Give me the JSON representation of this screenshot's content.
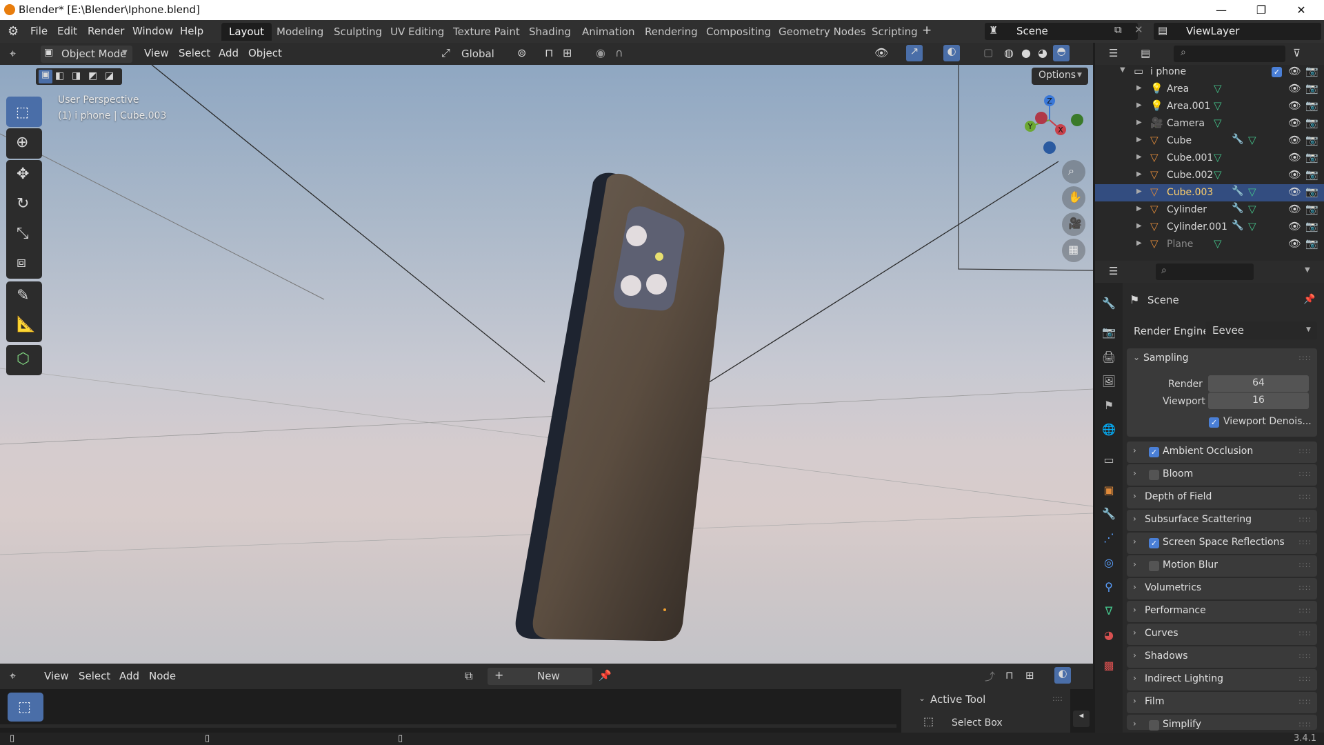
{
  "window": {
    "title": "Blender* [E:\\Blender\\Iphone.blend]",
    "controls": [
      "—",
      "❐",
      "✕"
    ]
  },
  "menu": [
    "File",
    "Edit",
    "Render",
    "Window",
    "Help"
  ],
  "workspaces": [
    {
      "label": "Layout",
      "active": true
    },
    {
      "label": "Modeling"
    },
    {
      "label": "Sculpting"
    },
    {
      "label": "UV Editing"
    },
    {
      "label": "Texture Paint"
    },
    {
      "label": "Shading"
    },
    {
      "label": "Animation"
    },
    {
      "label": "Rendering"
    },
    {
      "label": "Compositing"
    },
    {
      "label": "Geometry Nodes"
    },
    {
      "label": "Scripting"
    }
  ],
  "add_workspace": "+",
  "scene_name": "Scene",
  "view_layer": "ViewLayer",
  "viewport_header": {
    "mode": "Object Mode",
    "menus": [
      "View",
      "Select",
      "Add",
      "Object"
    ],
    "transform_orientation": "Global"
  },
  "viewport": {
    "perspective_label": "User Perspective",
    "object_label": "(1) i phone | Cube.003",
    "options_label": "Options",
    "gizmo_axes": {
      "x": "X",
      "y": "Y",
      "z": "Z"
    }
  },
  "outliner": {
    "collection": "i phone",
    "items": [
      {
        "name": "Area",
        "icon": "light-icon",
        "selected": false
      },
      {
        "name": "Area.001",
        "icon": "light-icon",
        "selected": false
      },
      {
        "name": "Camera",
        "icon": "camera-icon",
        "selected": false
      },
      {
        "name": "Cube",
        "icon": "mesh-icon",
        "selected": false
      },
      {
        "name": "Cube.001",
        "icon": "mesh-icon",
        "selected": false
      },
      {
        "name": "Cube.002",
        "icon": "mesh-icon",
        "selected": false
      },
      {
        "name": "Cube.003",
        "icon": "mesh-icon",
        "selected": true
      },
      {
        "name": "Cylinder",
        "icon": "mesh-icon",
        "selected": false
      },
      {
        "name": "Cylinder.001",
        "icon": "mesh-icon",
        "selected": false
      },
      {
        "name": "Plane",
        "icon": "mesh-icon",
        "selected": false
      }
    ]
  },
  "properties": {
    "context": "Scene",
    "render_engine_label": "Render Engine",
    "render_engine": "Eevee",
    "sampling": {
      "label": "Sampling",
      "render_label": "Render",
      "render_value": "64",
      "viewport_label": "Viewport",
      "viewport_value": "16",
      "denoise_label": "Viewport Denois..."
    },
    "panels": [
      {
        "label": "Ambient Occlusion",
        "checkbox": true
      },
      {
        "label": "Bloom",
        "checkbox": false
      },
      {
        "label": "Depth of Field"
      },
      {
        "label": "Subsurface Scattering"
      },
      {
        "label": "Screen Space Reflections",
        "checkbox": true
      },
      {
        "label": "Motion Blur",
        "checkbox": false
      },
      {
        "label": "Volumetrics"
      },
      {
        "label": "Performance"
      },
      {
        "label": "Curves"
      },
      {
        "label": "Shadows"
      },
      {
        "label": "Indirect Lighting"
      },
      {
        "label": "Film"
      },
      {
        "label": "Simplify",
        "checkbox": false
      }
    ]
  },
  "node_editor": {
    "menus": [
      "View",
      "Select",
      "Add",
      "Node"
    ],
    "new_label": "New",
    "active_tool_label": "Active Tool",
    "select_box_label": "Select Box"
  },
  "status": {
    "version": "3.4.1"
  },
  "colors": {
    "selection": "#334d80",
    "accent": "#4a7fd6",
    "blender_orange": "#e87d0d"
  }
}
